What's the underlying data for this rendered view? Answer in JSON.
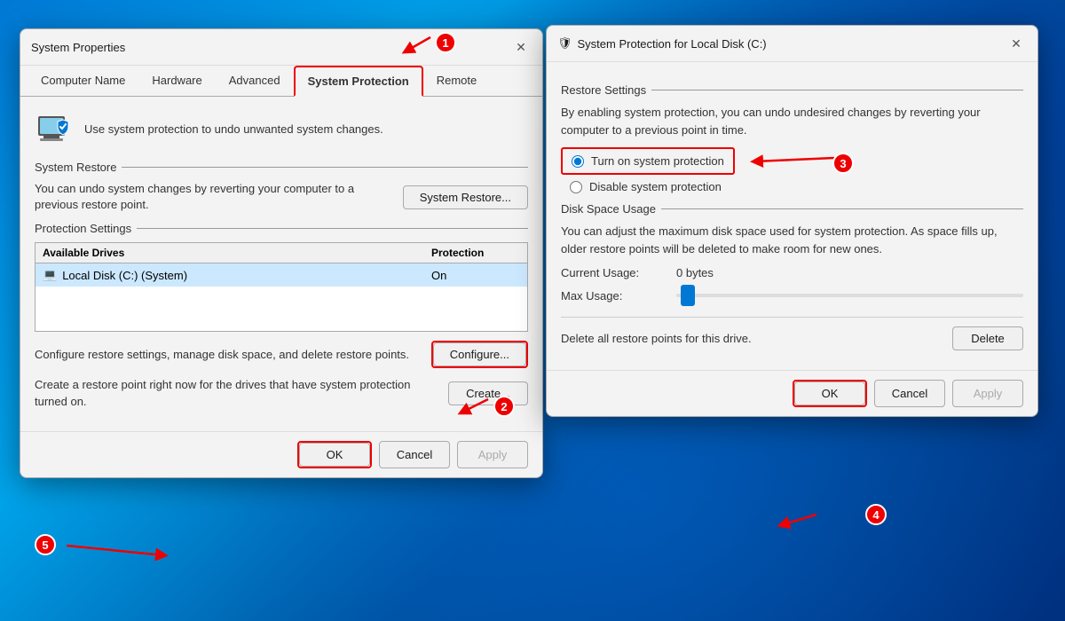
{
  "dialog1": {
    "title": "System Properties",
    "tabs": [
      {
        "label": "Computer Name",
        "active": false
      },
      {
        "label": "Hardware",
        "active": false
      },
      {
        "label": "Advanced",
        "active": false
      },
      {
        "label": "System Protection",
        "active": true
      },
      {
        "label": "Remote",
        "active": false
      }
    ],
    "info_text": "Use system protection to undo unwanted system changes.",
    "section_restore": "System Restore",
    "restore_description": "You can undo system changes by reverting your computer to a previous restore point.",
    "restore_button": "System Restore...",
    "section_protection": "Protection Settings",
    "table_col1": "Available Drives",
    "table_col2": "Protection",
    "drive_name": "Local Disk (C:) (System)",
    "drive_protection": "On",
    "configure_text": "Configure restore settings, manage disk space, and delete restore points.",
    "configure_button": "Configure...",
    "create_text": "Create a restore point right now for the drives that have system protection turned on.",
    "create_button": "Create...",
    "ok_button": "OK",
    "cancel_button": "Cancel",
    "apply_button": "Apply"
  },
  "dialog2": {
    "title": "System Protection for Local Disk (C:)",
    "title_icon": "🛡",
    "section_restore": "Restore Settings",
    "restore_desc1": "By enabling system protection, you can undo undesired changes by reverting your computer to a previous point in time.",
    "radio_on": "Turn on system protection",
    "radio_off": "Disable system protection",
    "section_disk": "Disk Space Usage",
    "disk_desc": "You can adjust the maximum disk space used for system protection. As space fills up, older restore points will be deleted to make room for new ones.",
    "current_label": "Current Usage:",
    "current_value": "0 bytes",
    "max_label": "Max Usage:",
    "delete_text": "Delete all restore points for this drive.",
    "delete_button": "Delete",
    "ok_button": "OK",
    "cancel_button": "Cancel",
    "apply_button": "Apply"
  },
  "annotations": [
    {
      "id": 1,
      "label": "1"
    },
    {
      "id": 2,
      "label": "2"
    },
    {
      "id": 3,
      "label": "3"
    },
    {
      "id": 4,
      "label": "4"
    },
    {
      "id": 5,
      "label": "5"
    }
  ]
}
